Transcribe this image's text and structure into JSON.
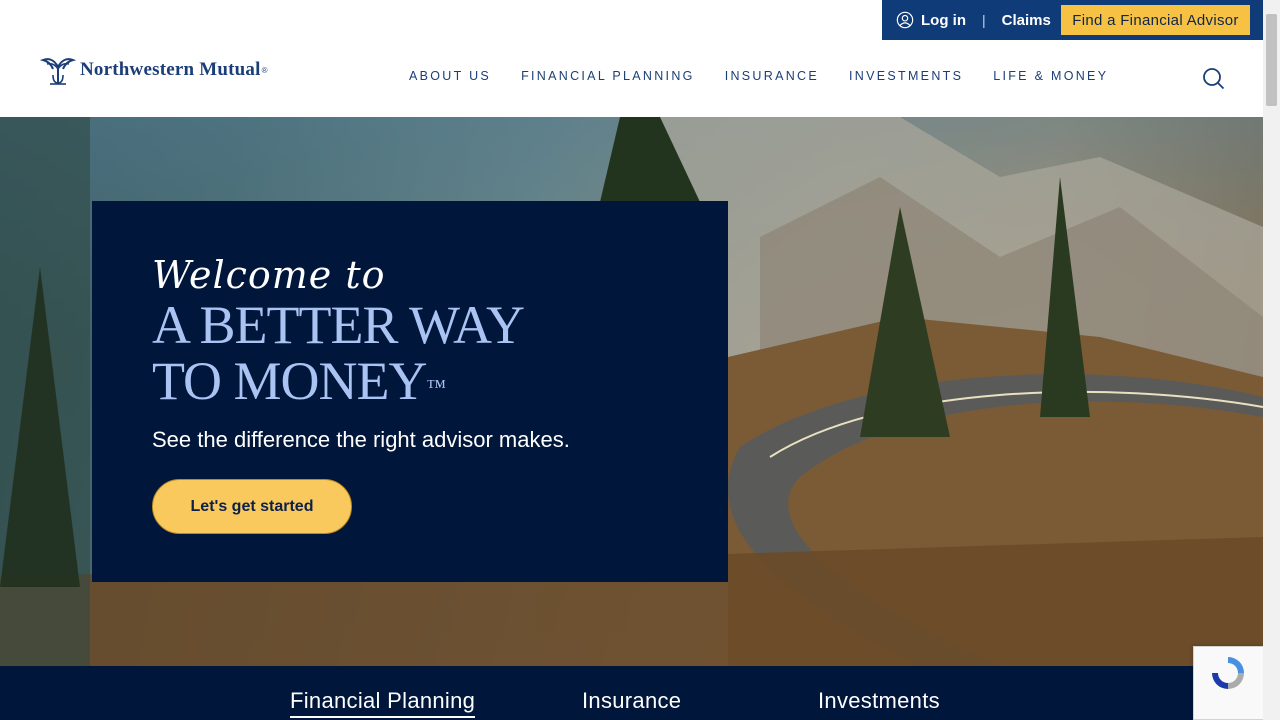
{
  "utility_bar": {
    "login_label": "Log in",
    "separator": "|",
    "claims_label": "Claims",
    "advisor_button_label": "Find a Financial Advisor"
  },
  "header": {
    "logo_text": "Northwestern Mutual",
    "logo_reg": "®",
    "nav": [
      "ABOUT US",
      "FINANCIAL PLANNING",
      "INSURANCE",
      "INVESTMENTS",
      "LIFE & MONEY"
    ],
    "search_icon": "search-icon"
  },
  "hero": {
    "welcome": "Welcome to",
    "headline_line1": "A BETTER WAY",
    "headline_line2": "TO MONEY",
    "trademark": "™",
    "subhead": "See the difference the right advisor makes.",
    "cta_label": "Let's get started"
  },
  "tabs": [
    {
      "label": "Financial Planning",
      "active": true
    },
    {
      "label": "Insurance",
      "active": false
    },
    {
      "label": "Investments",
      "active": false
    }
  ],
  "colors": {
    "navy": "#00163b",
    "brand_blue": "#0f3b78",
    "gold": "#f7c244",
    "headline_blue": "#a9c3f2"
  }
}
